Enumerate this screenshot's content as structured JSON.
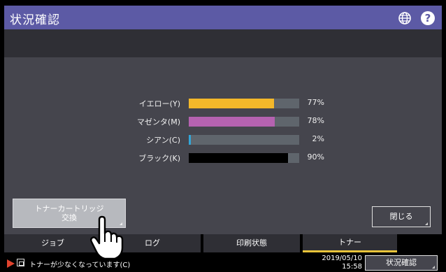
{
  "header": {
    "title": "状況確認",
    "globe_icon": "globe-icon",
    "help_icon": "help-icon",
    "help_label": "?",
    "accent": "#5c5aa5"
  },
  "toner": {
    "items": [
      {
        "label": "イエロー(Y)",
        "level": 0.77,
        "percent": "77%",
        "color": "#f3b82a"
      },
      {
        "label": "マゼンタ(M)",
        "level": 0.78,
        "percent": "78%",
        "color": "#b562b0"
      },
      {
        "label": "シアン(C)",
        "level": 0.02,
        "percent": "2%",
        "color": "#33a6d8"
      },
      {
        "label": "ブラック(K)",
        "level": 0.9,
        "percent": "90%",
        "color": "#000000"
      }
    ]
  },
  "buttons": {
    "replace_line1": "トナーカートリッジ",
    "replace_line2": "交換",
    "close": "閉じる"
  },
  "tabs": [
    {
      "label": "ジョブ",
      "active": false
    },
    {
      "label": "ログ",
      "active": false
    },
    {
      "label": "印刷状態",
      "active": false
    },
    {
      "label": "トナー",
      "active": true
    }
  ],
  "status": {
    "message": "トナーが少なくなっています(C)",
    "date": "2019/05/10",
    "time": "15:58",
    "button": "状況確認",
    "alert_color": "#e0432e"
  }
}
